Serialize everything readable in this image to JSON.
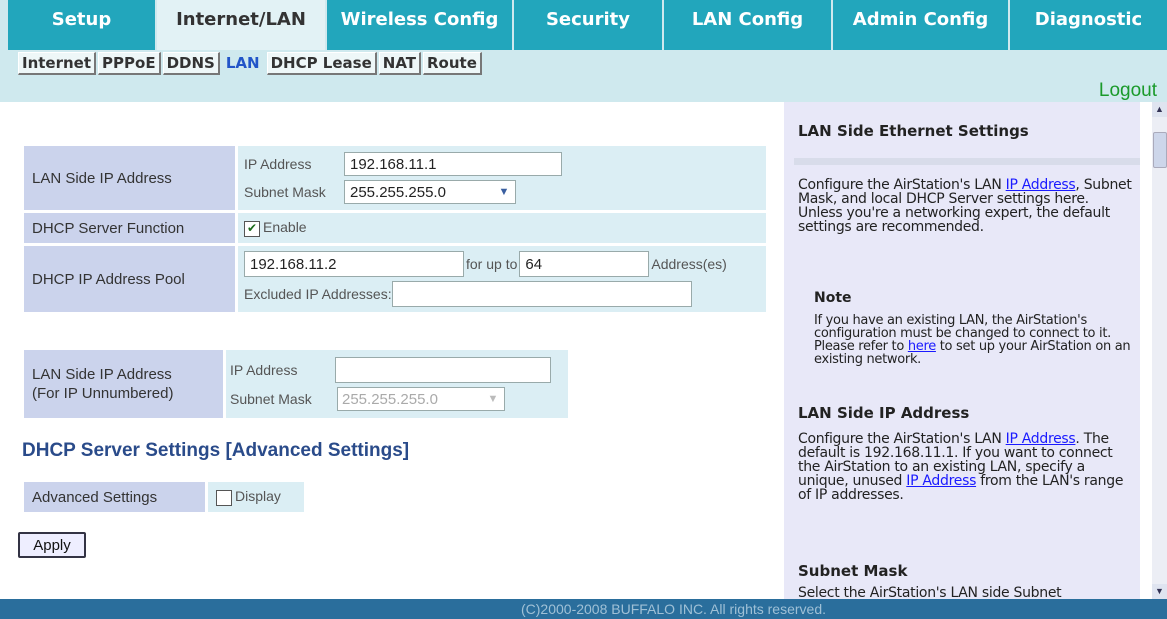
{
  "top_tabs": [
    {
      "label": "Setup",
      "active": false
    },
    {
      "label": "Internet/LAN",
      "active": true
    },
    {
      "label": "Wireless Config",
      "active": false
    },
    {
      "label": "Security",
      "active": false
    },
    {
      "label": "LAN Config",
      "active": false
    },
    {
      "label": "Admin Config",
      "active": false
    },
    {
      "label": "Diagnostic",
      "active": false
    }
  ],
  "sub_tabs": [
    {
      "label": "Internet",
      "active": false
    },
    {
      "label": "PPPoE",
      "active": false
    },
    {
      "label": "DDNS",
      "active": false
    },
    {
      "label": "LAN",
      "active": true
    },
    {
      "label": "DHCP Lease",
      "active": false
    },
    {
      "label": "NAT",
      "active": false
    },
    {
      "label": "Route",
      "active": false
    }
  ],
  "logout_label": "Logout",
  "lan_settings": {
    "lan_ip_label": "LAN Side IP Address",
    "ip_address_label": "IP Address",
    "ip_address_value": "192.168.11.1",
    "subnet_mask_label": "Subnet Mask",
    "subnet_mask_value": "255.255.255.0",
    "dhcp_function_label": "DHCP Server Function",
    "dhcp_enable_label": "Enable",
    "dhcp_enabled": true,
    "dhcp_pool_label": "DHCP IP Address Pool",
    "pool_start_value": "192.168.11.2",
    "for_up_to_label": "for up to",
    "pool_count_value": "64",
    "addresses_label": "Address(es)",
    "excluded_label": "Excluded IP Addresses:",
    "excluded_value": ""
  },
  "unnumbered": {
    "label_line1": "LAN Side IP Address",
    "label_line2": "(For IP Unnumbered)",
    "ip_address_label": "IP Address",
    "ip_address_value": "",
    "subnet_mask_label": "Subnet Mask",
    "subnet_mask_value": "255.255.255.0"
  },
  "advanced": {
    "title": "DHCP Server Settings [Advanced Settings]",
    "label": "Advanced Settings",
    "display_label": "Display",
    "display_checked": false
  },
  "apply_label": "Apply",
  "help": {
    "title1": "LAN Side Ethernet Settings",
    "p1_pre": "Configure the AirStation's LAN ",
    "p1_link": "IP Address",
    "p1_post": ", Subnet Mask, and local DHCP Server settings here. Unless you're a networking expert, the default settings are recommended.",
    "note_title": "Note",
    "note_pre": "If you have an existing LAN, the AirStation's configuration must be changed to connect to it. Please refer to ",
    "note_link": "here",
    "note_post": " to set up your AirStation on an existing network.",
    "title2": "LAN Side IP Address",
    "p2_pre": "Configure the AirStation's LAN ",
    "p2_link1": "IP Address",
    "p2_mid": ". The default is 192.168.11.1. If you want to connect the AirStation to an existing LAN, specify a unique, unused ",
    "p2_link2": "IP Address",
    "p2_post": " from the LAN's range of IP addresses.",
    "title3": "Subnet Mask",
    "p3": "Select the AirStation's LAN side Subnet"
  },
  "footer_text": "(C)2000-2008 BUFFALO INC. All rights reserved.",
  "colors": {
    "tab_bg": "#22a6bc",
    "link": "#1a1aff",
    "logout": "#1a9a2a",
    "footer": "#2a6e9c"
  }
}
